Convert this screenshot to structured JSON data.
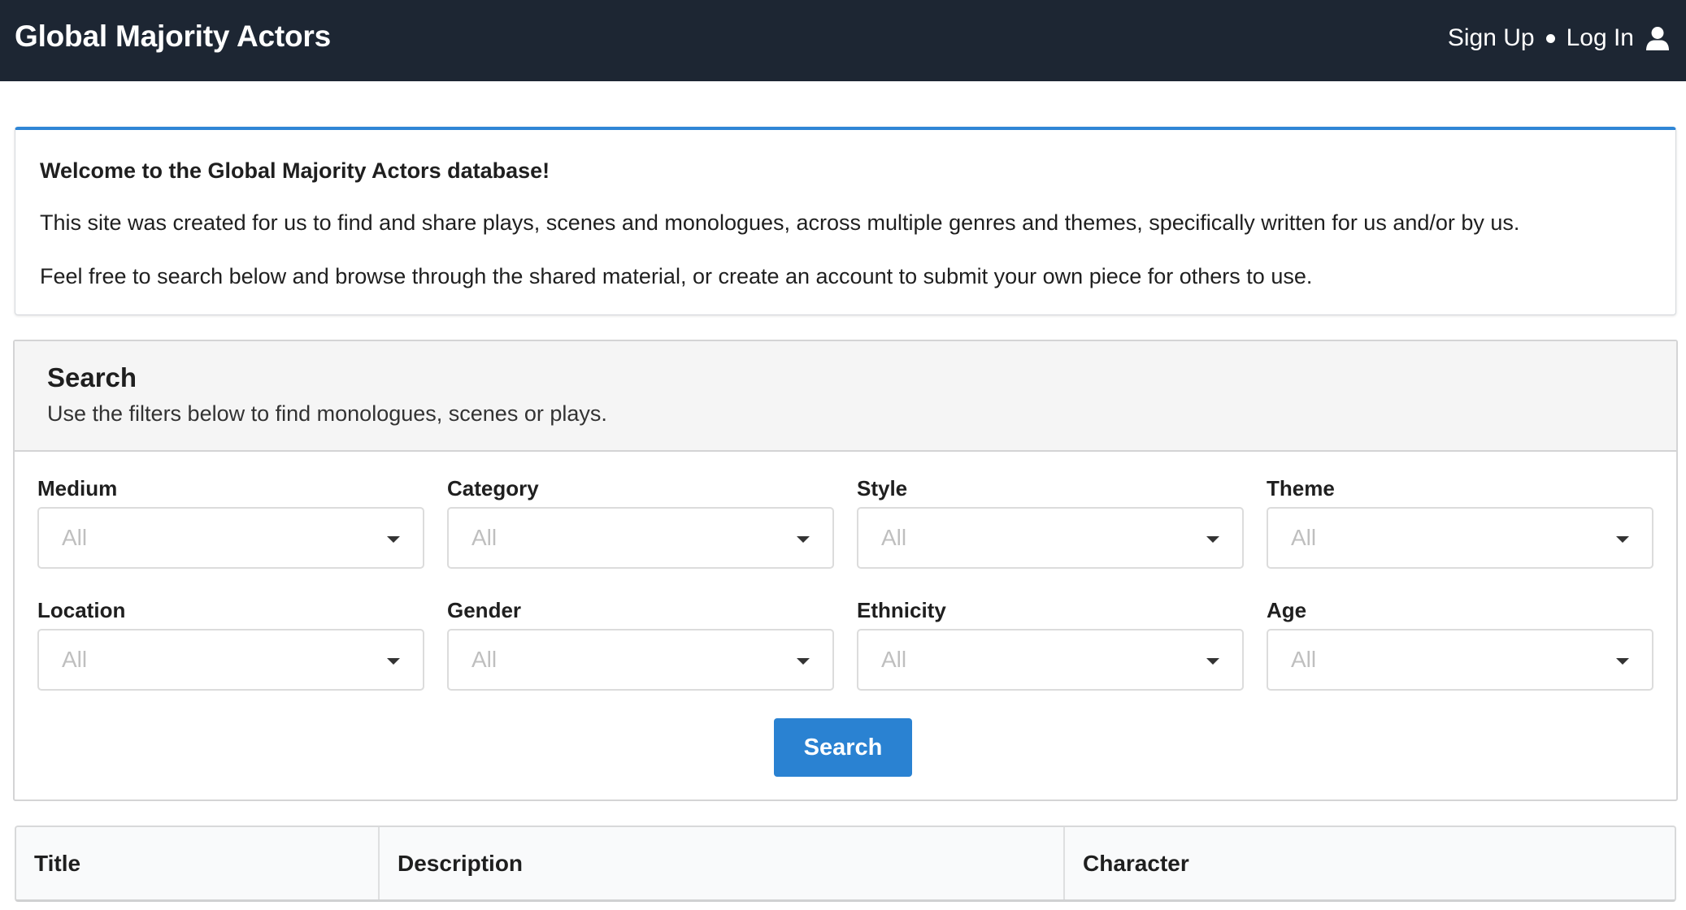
{
  "header": {
    "brand": "Global Majority Actors",
    "signup_label": "Sign Up",
    "login_label": "Log In",
    "user_icon": "user-icon"
  },
  "welcome": {
    "title": "Welcome to the Global Majority Actors database!",
    "paragraph1": "This site was created for us to find and share plays, scenes and monologues, across multiple genres and themes, specifically written for us and/or by us.",
    "paragraph2": "Feel free to search below and browse through the shared material, or create an account to submit your own piece for others to use."
  },
  "search": {
    "title": "Search",
    "subtitle": "Use the filters below to find monologues, scenes or plays.",
    "button_label": "Search",
    "filters": [
      {
        "label": "Medium",
        "value": "All"
      },
      {
        "label": "Category",
        "value": "All"
      },
      {
        "label": "Style",
        "value": "All"
      },
      {
        "label": "Theme",
        "value": "All"
      },
      {
        "label": "Location",
        "value": "All"
      },
      {
        "label": "Gender",
        "value": "All"
      },
      {
        "label": "Ethnicity",
        "value": "All"
      },
      {
        "label": "Age",
        "value": "All"
      }
    ]
  },
  "results": {
    "columns": [
      "Title",
      "Description",
      "Character"
    ]
  },
  "colors": {
    "navbar": "#1d2633",
    "accent": "#2a82d2",
    "welcome_border": "#2f86d6",
    "placeholder": "#bfbfbf"
  }
}
